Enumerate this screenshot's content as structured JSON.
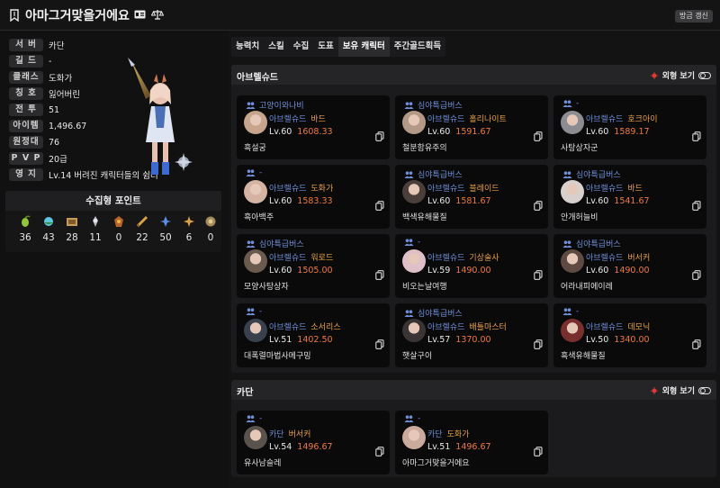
{
  "header": {
    "title": "아마그거맞을거에요",
    "refresh_label": "방금 갱신"
  },
  "profile": {
    "rows": [
      {
        "label": "서 버",
        "value": "카단"
      },
      {
        "label": "길 드",
        "value": "-"
      },
      {
        "label": "클래스",
        "value": "도화가"
      },
      {
        "label": "칭 호",
        "value": "잃어버린"
      },
      {
        "label": "전 투",
        "value": "51"
      },
      {
        "label": "아이템",
        "value": "1,496.67"
      },
      {
        "label": "원정대",
        "value": "76"
      },
      {
        "label": "P V P",
        "value": "20급"
      },
      {
        "label": "영 지",
        "value": "Lv.14 버려진 캐릭터들의 쉼터"
      }
    ]
  },
  "collect": {
    "title": "수집형 포인트",
    "items": [
      {
        "icon": "mokoko-seed-icon",
        "value": "36"
      },
      {
        "icon": "island-heart-icon",
        "value": "43"
      },
      {
        "icon": "great-art-icon",
        "value": "28"
      },
      {
        "icon": "giant-heart-icon",
        "value": "11"
      },
      {
        "icon": "ignea-token-icon",
        "value": "0"
      },
      {
        "icon": "adventure-record-icon",
        "value": "22"
      },
      {
        "icon": "world-tree-leaf-icon",
        "value": "50"
      },
      {
        "icon": "orpheus-star-icon",
        "value": "6"
      },
      {
        "icon": "orgel-icon",
        "value": "0"
      }
    ]
  },
  "tabs": [
    "능력치",
    "스킬",
    "수집",
    "도표",
    "보유 캐릭터",
    "주간골드획득"
  ],
  "active_tab": "보유 캐릭터",
  "servers": [
    {
      "name": "아브렐슈드",
      "toggle_label": "외형 보기",
      "characters": [
        {
          "guild": "고양이와나비",
          "server": "아브렐슈드",
          "class": "바드",
          "level": "Lv.60",
          "item_level": "1608.33",
          "name": "흑설궁"
        },
        {
          "guild": "심야특급버스",
          "server": "아브렐슈드",
          "class": "홀리나이트",
          "level": "Lv.60",
          "item_level": "1591.67",
          "name": "철분함유주의"
        },
        {
          "guild": "-",
          "server": "아브렐슈드",
          "class": "호크아이",
          "level": "Lv.60",
          "item_level": "1589.17",
          "name": "사탕상자군"
        },
        {
          "guild": "-",
          "server": "아브렐슈드",
          "class": "도화가",
          "level": "Lv.60",
          "item_level": "1583.33",
          "name": "흑아백주"
        },
        {
          "guild": "심야특급버스",
          "server": "아브렐슈드",
          "class": "블레이드",
          "level": "Lv.60",
          "item_level": "1581.67",
          "name": "백색유해물질"
        },
        {
          "guild": "심야특급버스",
          "server": "아브렐슈드",
          "class": "바드",
          "level": "Lv.60",
          "item_level": "1541.67",
          "name": "안개허늘비"
        },
        {
          "guild": "심야특급버스",
          "server": "아브렐슈드",
          "class": "워로드",
          "level": "Lv.60",
          "item_level": "1505.00",
          "name": "모양사탕상자"
        },
        {
          "guild": "-",
          "server": "아브렐슈드",
          "class": "기상술사",
          "level": "Lv.59",
          "item_level": "1490.00",
          "name": "비오는날여행"
        },
        {
          "guild": "심야특급버스",
          "server": "아브렐슈드",
          "class": "버서커",
          "level": "Lv.60",
          "item_level": "1490.00",
          "name": "어라내피에이레"
        },
        {
          "guild": "-",
          "server": "아브렐슈드",
          "class": "소서리스",
          "level": "Lv.51",
          "item_level": "1402.50",
          "name": "대폭렬마법사메구밍"
        },
        {
          "guild": "심야특급버스",
          "server": "아브렐슈드",
          "class": "배틀마스터",
          "level": "Lv.57",
          "item_level": "1370.00",
          "name": "햇살구이"
        },
        {
          "guild": "-",
          "server": "아브렐슈드",
          "class": "데모닉",
          "level": "Lv.50",
          "item_level": "1340.00",
          "name": "흑색유해물질"
        }
      ]
    },
    {
      "name": "카단",
      "toggle_label": "외형 보기",
      "characters": [
        {
          "guild": "-",
          "server": "카단",
          "class": "버서커",
          "level": "Lv.54",
          "item_level": "1496.67",
          "name": "유사남슬레"
        },
        {
          "guild": "-",
          "server": "카단",
          "class": "도화가",
          "level": "Lv.51",
          "item_level": "1496.67",
          "name": "아마그거맞을거에요"
        }
      ]
    }
  ],
  "colors": {
    "guild_blue": "#6f8fd8",
    "class_orange": "#e9a04a",
    "item_level_orange": "#ef7a3e",
    "toggle_dot_red": "#e53935"
  }
}
